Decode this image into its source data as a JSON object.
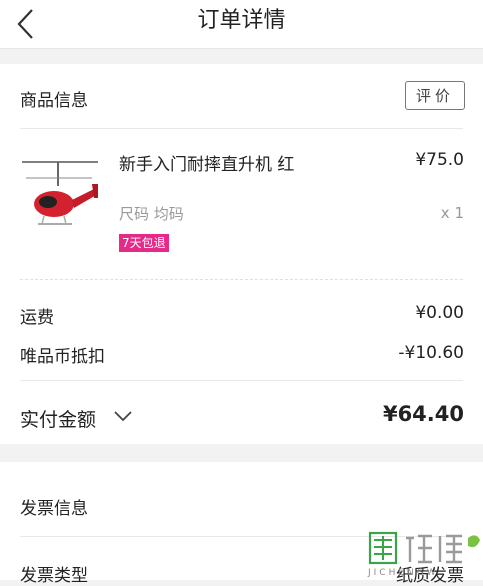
{
  "header": {
    "title": "订单详情"
  },
  "product_section": {
    "title": "商品信息",
    "rate_button": "评价",
    "item": {
      "name": "新手入门耐摔直升机 红",
      "price": "¥75.0",
      "spec": "尺码  均码",
      "quantity": "x 1",
      "badge": "7天包退"
    }
  },
  "costs": {
    "shipping_label": "运费",
    "shipping_value": "¥0.00",
    "coin_label": "唯品币抵扣",
    "coin_value": "-¥10.60"
  },
  "total": {
    "label": "实付金额",
    "value": "¥64.40"
  },
  "invoice": {
    "title": "发票信息",
    "type_label": "发票类型",
    "type_value": "纸质发票"
  },
  "watermark": {
    "text": "JICHENGW"
  },
  "colors": {
    "badge": "#e52a8a",
    "page_bg": "#f2f2f2"
  }
}
